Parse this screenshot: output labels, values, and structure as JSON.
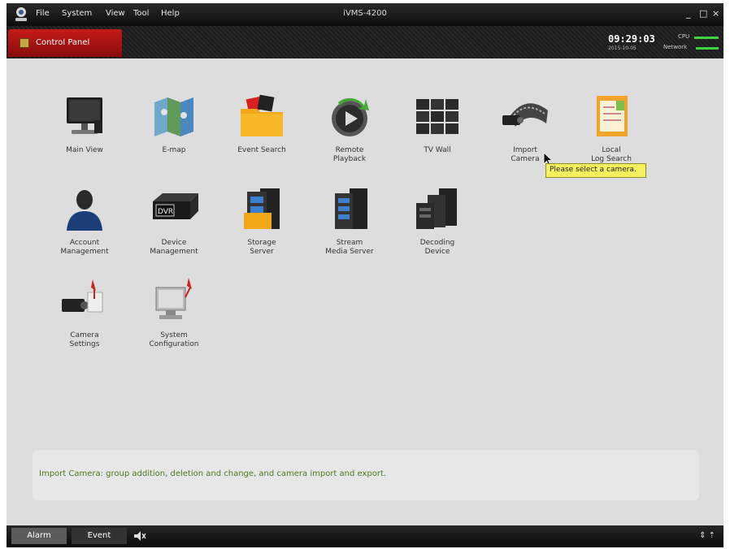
{
  "menu": [
    "File",
    "System",
    "View",
    "Tool",
    "Help"
  ],
  "window_title": "iVMS-4200",
  "window_controls": [
    "_",
    "□",
    "×"
  ],
  "tab": {
    "label": "Control Panel"
  },
  "clock": {
    "time": "09:29:03",
    "date": "2015-10-05"
  },
  "status": {
    "cpu_label": "CPU",
    "net_label": "Network"
  },
  "modules": [
    {
      "id": "main-view",
      "label": "Main View",
      "icon": "monitor-icon"
    },
    {
      "id": "e-map",
      "label": "E-map",
      "icon": "map-icon"
    },
    {
      "id": "event-search",
      "label": "Event Search",
      "icon": "folder-icon"
    },
    {
      "id": "remote-playback",
      "label": "Remote\nPlayback",
      "icon": "playback-icon"
    },
    {
      "id": "tv-wall",
      "label": "TV Wall",
      "icon": "tv-wall-icon"
    },
    {
      "id": "import-camera",
      "label": "Import\nCamera",
      "icon": "camera-film-icon"
    },
    {
      "id": "log-search",
      "label": "Local\nLog Search",
      "icon": "log-book-icon"
    },
    {
      "id": "account-management",
      "label": "Account\nManagement",
      "icon": "user-icon"
    },
    {
      "id": "device-management",
      "label": "Device\nManagement",
      "icon": "dvr-icon"
    },
    {
      "id": "storage-server",
      "label": "Storage\nServer",
      "icon": "storage-server-icon"
    },
    {
      "id": "stream-media-server",
      "label": "Stream\nMedia Server",
      "icon": "stream-server-icon"
    },
    {
      "id": "decoding-device",
      "label": "Decoding\nDevice",
      "icon": "decoder-icon"
    },
    {
      "id": "camera-settings",
      "label": "Camera\nSettings",
      "icon": "camera-settings-icon"
    },
    {
      "id": "system-configuration",
      "label": "System\nConfiguration",
      "icon": "system-config-icon"
    }
  ],
  "tooltip": "Please select a camera.",
  "hint": "Import Camera: group addition, deletion and change, and camera import and export.",
  "bottom": {
    "alarm_label": "Alarm",
    "event_label": "Event"
  }
}
